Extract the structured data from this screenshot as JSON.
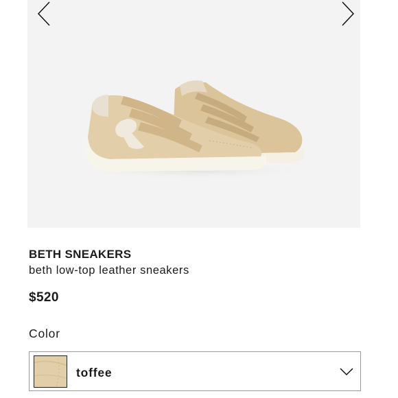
{
  "product": {
    "name": "BETH SNEAKERS",
    "subtitle": "beth low-top leather sneakers",
    "price": "$520"
  },
  "color_selector": {
    "label": "Color",
    "selected": "toffee",
    "swatch_color": "#e2cfa9"
  },
  "gallery": {
    "background": "#f3f3f3",
    "image": "sneaker-pair-image",
    "prev_icon": "chevron-left-icon",
    "next_icon": "chevron-right-icon"
  },
  "icons": {
    "dropdown": "chevron-down-icon"
  }
}
